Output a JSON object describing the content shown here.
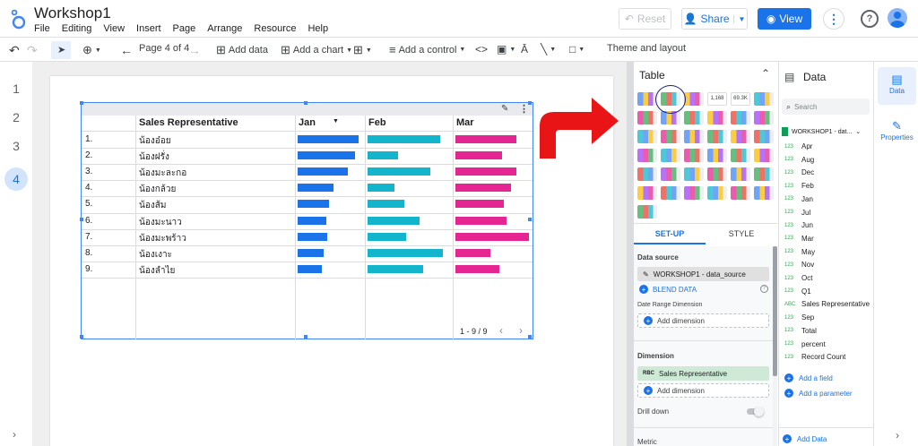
{
  "app": {
    "title": "Workshop1",
    "menu": [
      "File",
      "Editing",
      "View",
      "Insert",
      "Page",
      "Arrange",
      "Resource",
      "Help"
    ]
  },
  "header": {
    "reset_label": "Reset",
    "share_label": "Share",
    "view_label": "View"
  },
  "toolbar": {
    "page_label": "Page 4 of 4",
    "add_data_label": "Add data",
    "add_chart_label": "Add a chart",
    "add_control_label": "Add a control",
    "theme_label": "Theme and layout"
  },
  "pages": [
    "1",
    "2",
    "3",
    "4"
  ],
  "table": {
    "columns": [
      "Sales Representative",
      "Jan",
      "Feb",
      "Mar"
    ],
    "rows": [
      {
        "num": "1.",
        "name": "น้องอ๋อย",
        "jan": 1.0,
        "feb": 0.97,
        "mar": 0.83
      },
      {
        "num": "2.",
        "name": "น้องฝรั่ง",
        "jan": 0.94,
        "feb": 0.41,
        "mar": 0.63
      },
      {
        "num": "3.",
        "name": "น้องมะละกอ",
        "jan": 0.83,
        "feb": 0.83,
        "mar": 0.83
      },
      {
        "num": "4.",
        "name": "น้องกล้วย",
        "jan": 0.59,
        "feb": 0.36,
        "mar": 0.75
      },
      {
        "num": "5.",
        "name": "น้องส้ม",
        "jan": 0.51,
        "feb": 0.49,
        "mar": 0.66
      },
      {
        "num": "6.",
        "name": "น้องมะนาว",
        "jan": 0.47,
        "feb": 0.69,
        "mar": 0.7
      },
      {
        "num": "7.",
        "name": "น้องมะพร้าว",
        "jan": 0.48,
        "feb": 0.51,
        "mar": 1.0
      },
      {
        "num": "8.",
        "name": "น้องเงาะ",
        "jan": 0.43,
        "feb": 1.0,
        "mar": 0.48
      },
      {
        "num": "9.",
        "name": "น้องลำไย",
        "jan": 0.39,
        "feb": 0.74,
        "mar": 0.6
      }
    ],
    "pagination": "1 - 9 / 9"
  },
  "chart_panel": {
    "title": "Table",
    "tabs": [
      "SET-UP",
      "STYLE"
    ],
    "data_source_label": "Data source",
    "data_source": "WORKSHOP1 - data_source",
    "blend": "BLEND DATA",
    "date_range_label": "Date Range Dimension",
    "add_dimension": "Add dimension",
    "dimension_label": "Dimension",
    "dimension_value": "Sales Representative",
    "add_dimension2": "Add dimension",
    "drill_down": "Drill down",
    "metric": "Metric",
    "scorecard_values": [
      "1,168",
      "69.3K"
    ]
  },
  "data_panel": {
    "title": "Data",
    "search_placeholder": "Search",
    "source": "WORKSHOP1 - dat...",
    "fields": [
      {
        "type": "123",
        "name": "Apr"
      },
      {
        "type": "123",
        "name": "Aug"
      },
      {
        "type": "123",
        "name": "Dec"
      },
      {
        "type": "123",
        "name": "Feb"
      },
      {
        "type": "123",
        "name": "Jan"
      },
      {
        "type": "123",
        "name": "Jul"
      },
      {
        "type": "123",
        "name": "Jun"
      },
      {
        "type": "123",
        "name": "Mar"
      },
      {
        "type": "123",
        "name": "May"
      },
      {
        "type": "123",
        "name": "Nov"
      },
      {
        "type": "123",
        "name": "Oct"
      },
      {
        "type": "123",
        "name": "Q1"
      },
      {
        "type": "ABC",
        "name": "Sales Representative"
      },
      {
        "type": "123",
        "name": "Sep"
      },
      {
        "type": "123",
        "name": "Total"
      },
      {
        "type": "123",
        "name": "percent"
      },
      {
        "type": "123",
        "name": "Record Count"
      }
    ],
    "add_field": "Add a field",
    "add_parameter": "Add a parameter",
    "add_data": "Add Data"
  },
  "rail": {
    "data": "Data",
    "properties": "Properties"
  },
  "colors": {
    "jan": "#1a73e8",
    "feb": "#12b5cb",
    "mar": "#e52592",
    "accent": "#1a73e8",
    "arrow": "#e81416"
  }
}
